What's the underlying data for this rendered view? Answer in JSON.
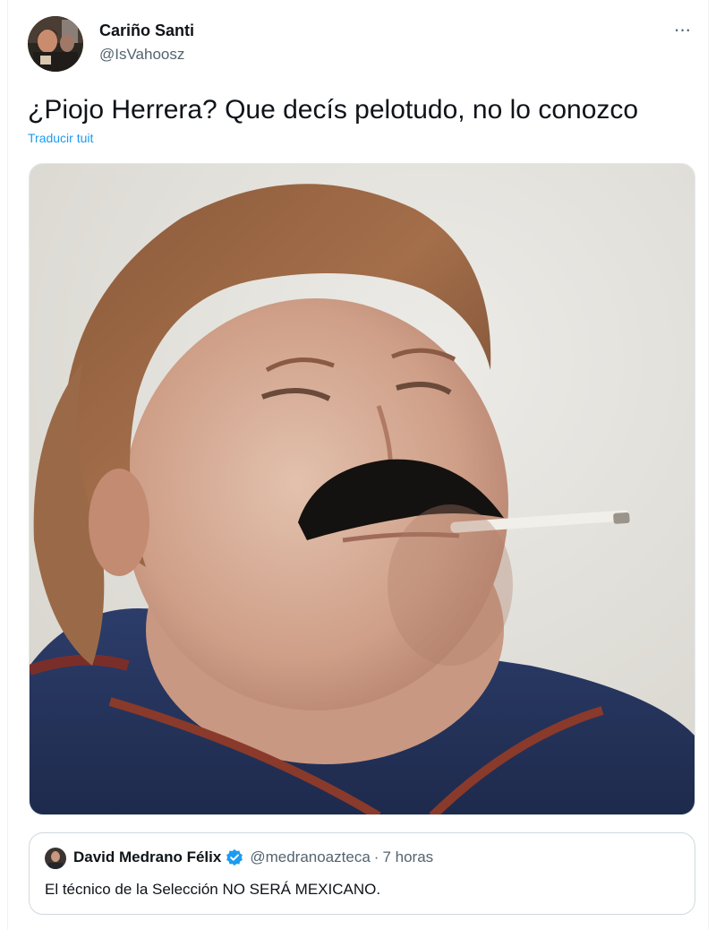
{
  "author": {
    "display_name": "Cariño Santi",
    "handle": "@IsVahoosz",
    "avatar_icon": "user-avatar"
  },
  "more_icon": "more-horizontal-icon",
  "more_label": "···",
  "tweet": {
    "text": "¿Piojo Herrera? Que decís pelotudo, no lo conozco",
    "translate_label": "Traducir tuit"
  },
  "media": {
    "icon": "photo-meme-man-with-mustache-and-cigarette"
  },
  "quoted_tweet": {
    "display_name": "David Medrano Félix",
    "verified_icon": "verified-badge-icon",
    "handle": "@medranoazteca",
    "separator": "·",
    "time": "7 horas",
    "text": "El técnico de la Selección NO SERÁ MEXICANO."
  },
  "colors": {
    "text": "#0f1419",
    "secondary": "#536471",
    "link": "#1d9bf0",
    "border": "#cfd9de"
  }
}
